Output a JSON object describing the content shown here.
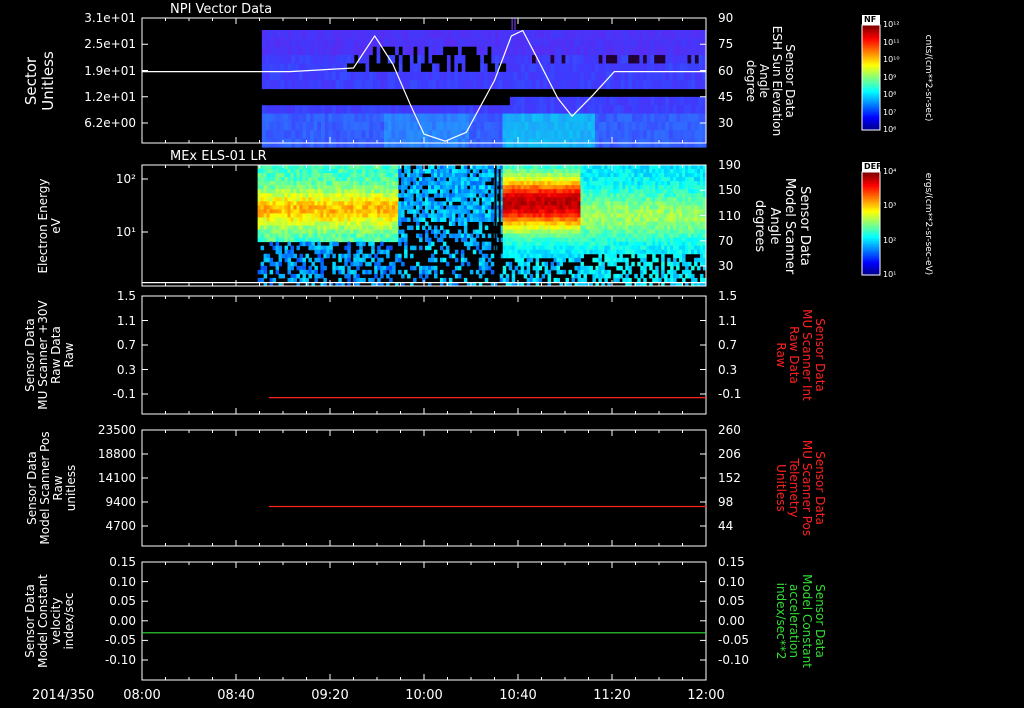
{
  "time_axis": {
    "date_label": "2014/350",
    "ticks": [
      "08:00",
      "08:40",
      "09:20",
      "10:00",
      "10:40",
      "11:20",
      "12:00"
    ],
    "tick_hours": [
      8.0,
      8.6667,
      9.3333,
      10.0,
      10.6667,
      11.3333,
      12.0
    ],
    "range_hours": [
      8.0,
      12.0
    ]
  },
  "colors": {
    "white": "#ffffff",
    "red": "#ff2020",
    "green": "#33dd33",
    "bg": "#000000"
  },
  "panels": [
    {
      "id": "p1",
      "title": "NPI Vector Data",
      "left_label": [
        "Sector",
        "Unitless"
      ],
      "right_label": [
        "Sensor Data",
        "ESH Sun Elevation",
        "Angle",
        "degree"
      ],
      "right_label_color": "#ffffff",
      "left_ticks": [
        "3.1e+01",
        "2.5e+01",
        "1.9e+01",
        "1.2e+01",
        "6.2e+00"
      ],
      "right_ticks": [
        "90",
        "75",
        "60",
        "45",
        "30"
      ],
      "colorbar": {
        "title": "NF",
        "unit": "cnts/(cm**2-sr-sec)",
        "ticks": [
          "10¹²",
          "10¹¹",
          "10¹⁰",
          "10⁹",
          "10⁸",
          "10⁷",
          "10⁶"
        ]
      }
    },
    {
      "id": "p2",
      "title": "MEx ELS-01 LR",
      "left_label": [
        "Electron Energy",
        "eV"
      ],
      "right_label": [
        "Sensor Data",
        "Model Scanner",
        "Angle",
        "degrees"
      ],
      "right_label_color": "#ffffff",
      "left_ticks": [
        "10²",
        "10¹"
      ],
      "right_ticks": [
        "190",
        "150",
        "110",
        "70",
        "30"
      ],
      "colorbar": {
        "title": "DEF",
        "unit": "ergs/(cm**2-sr-sec-eV)",
        "ticks": [
          "10⁴",
          "10³",
          "10²",
          "10¹"
        ]
      }
    },
    {
      "id": "p3",
      "title": "",
      "left_label": [
        "Sensor Data",
        "MU Scanner +30V",
        "Raw Data",
        "Raw"
      ],
      "right_label": [
        "Sensor Data",
        "MU Scanner Int",
        "Raw Data",
        "Raw"
      ],
      "right_label_color": "#ff2020",
      "left_ticks": [
        "1.5",
        "1.1",
        "0.7",
        "0.3",
        "-0.1"
      ],
      "right_ticks": [
        "1.5",
        "1.1",
        "0.7",
        "0.3",
        "-0.1"
      ]
    },
    {
      "id": "p4",
      "title": "",
      "left_label": [
        "Sensor Data",
        "Model Scanner Pos",
        "Raw",
        "unitless"
      ],
      "right_label": [
        "Sensor Data",
        "MU Scanner Pos",
        "Telemetry",
        "Unitless"
      ],
      "right_label_color": "#ff2020",
      "left_ticks": [
        "23500",
        "18800",
        "14100",
        "9400",
        "4700"
      ],
      "right_ticks": [
        "260",
        "206",
        "152",
        "98",
        "44"
      ]
    },
    {
      "id": "p5",
      "title": "",
      "left_label": [
        "Sensor Data",
        "Model Constant",
        "velocity",
        "index/sec"
      ],
      "right_label": [
        "Sensor Data",
        "Model Constant",
        "acceleration",
        "index/sec**2"
      ],
      "right_label_color": "#33dd33",
      "left_ticks": [
        "0.15",
        "0.10",
        "0.05",
        "0.00",
        "-0.05",
        "-0.10"
      ],
      "right_ticks": [
        "0.15",
        "0.10",
        "0.05",
        "0.00",
        "-0.05",
        "-0.10"
      ]
    }
  ],
  "chart_data": [
    {
      "type": "heatmap",
      "panel": "p1",
      "title": "NPI Vector Data",
      "overlay_line": {
        "ylim": [
          20,
          90
        ],
        "x": [
          8.0,
          9.05,
          9.5,
          9.65,
          9.78,
          9.9,
          10.0,
          10.15,
          10.3,
          10.5,
          10.62,
          10.7,
          10.8,
          10.95,
          11.05,
          11.2,
          11.35,
          12.0
        ],
        "y": [
          60,
          60,
          62,
          80,
          64,
          42,
          25,
          21,
          26,
          55,
          80,
          83,
          68,
          45,
          35,
          47,
          60,
          60
        ]
      }
    },
    {
      "type": "heatmap",
      "panel": "p2",
      "title": "MEx ELS-01 LR",
      "xlabel": "",
      "ylabel": "Electron Energy eV",
      "overlay_line": {
        "ylim": [
          10,
          190
        ],
        "x": [
          8.0,
          12.0
        ],
        "y": [
          15,
          15
        ]
      }
    },
    {
      "type": "line",
      "panel": "p3",
      "ylim": [
        -0.3,
        1.5
      ],
      "series": [
        {
          "color": "#ff2020",
          "x": [
            8.9,
            12.0
          ],
          "y": [
            -0.05,
            -0.05
          ]
        }
      ]
    },
    {
      "type": "line",
      "panel": "p4",
      "ylim": [
        0,
        23500
      ],
      "series": [
        {
          "color": "#ff2020",
          "x": [
            8.9,
            12.0
          ],
          "y": [
            8000,
            8000
          ]
        }
      ]
    },
    {
      "type": "line",
      "panel": "p5",
      "ylim": [
        -0.1,
        0.15
      ],
      "series": [
        {
          "color": "#33dd33",
          "x": [
            8.0,
            12.0
          ],
          "y": [
            0.0,
            0.0
          ]
        }
      ]
    }
  ]
}
